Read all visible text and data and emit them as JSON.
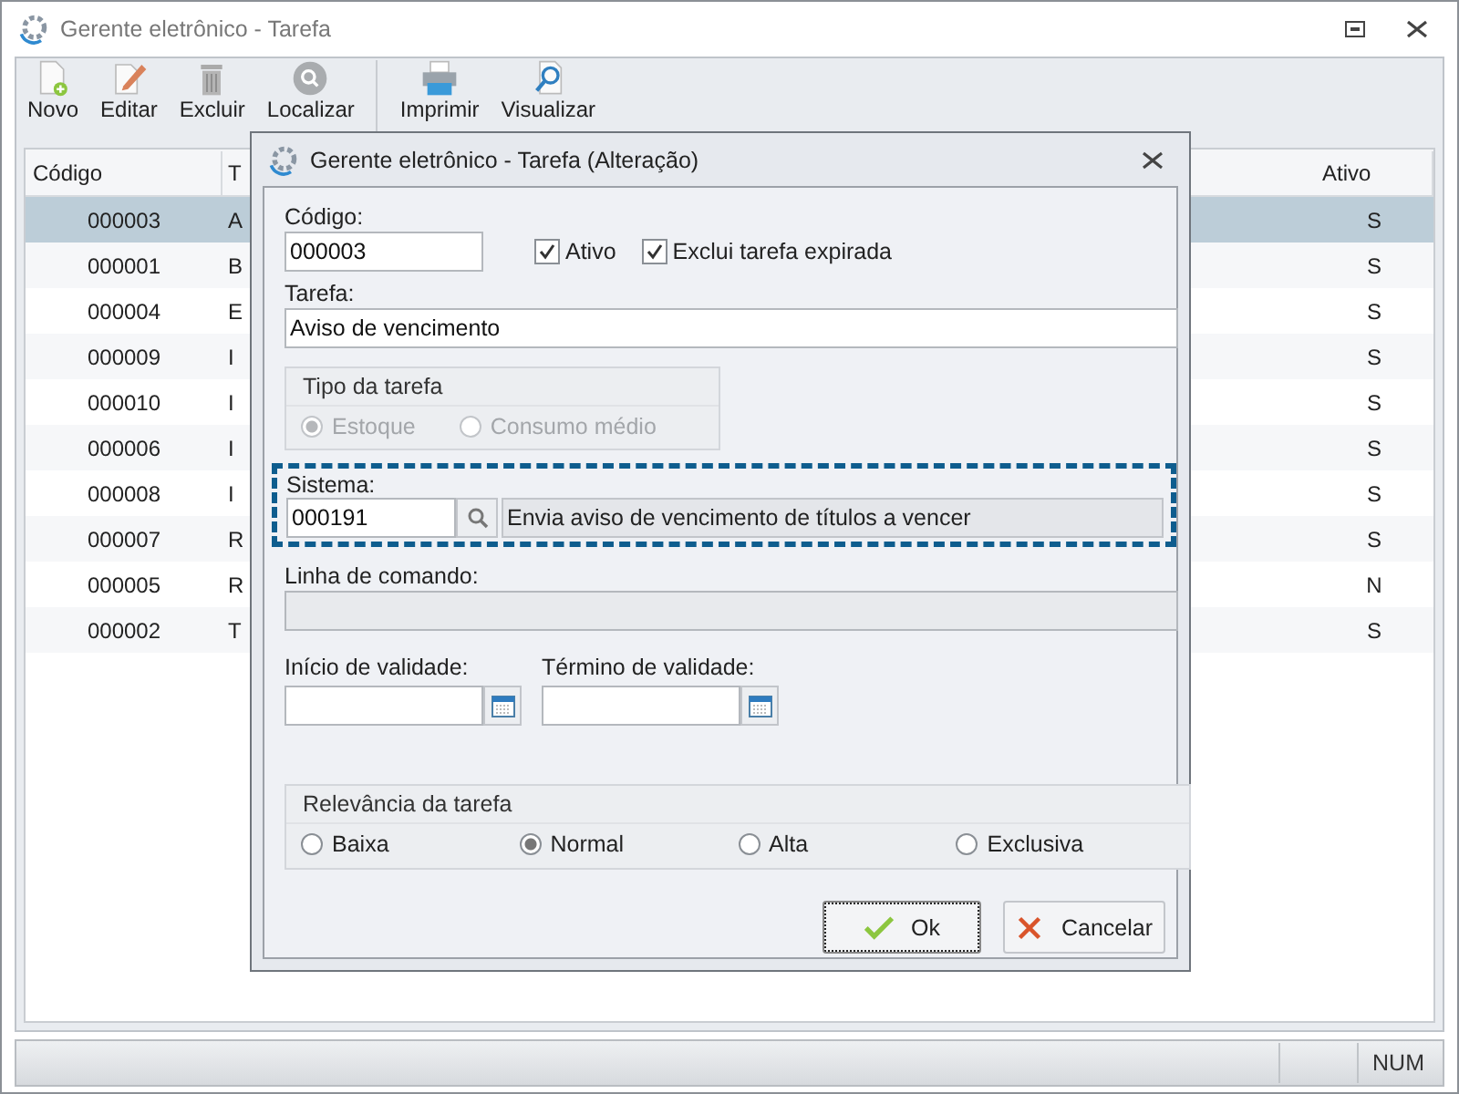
{
  "window": {
    "title": "Gerente eletrônico - Tarefa"
  },
  "toolbar": [
    {
      "label": "Novo"
    },
    {
      "label": "Editar"
    },
    {
      "label": "Excluir"
    },
    {
      "label": "Localizar"
    },
    {
      "label": "Imprimir"
    },
    {
      "label": "Visualizar"
    }
  ],
  "table": {
    "columns": [
      "Código",
      "T",
      "Ativo"
    ],
    "rows": [
      {
        "cells": [
          "000003",
          "A",
          "S"
        ],
        "selected": true
      },
      {
        "cells": [
          "000001",
          "B",
          "S"
        ],
        "selected": false
      },
      {
        "cells": [
          "000004",
          "E",
          "S"
        ],
        "selected": false
      },
      {
        "cells": [
          "000009",
          "I",
          "S"
        ],
        "selected": false
      },
      {
        "cells": [
          "000010",
          "I",
          "S"
        ],
        "selected": false
      },
      {
        "cells": [
          "000006",
          "I",
          "S"
        ],
        "selected": false
      },
      {
        "cells": [
          "000008",
          "I",
          "S"
        ],
        "selected": false
      },
      {
        "cells": [
          "000007",
          "R",
          "S"
        ],
        "selected": false
      },
      {
        "cells": [
          "000005",
          "R",
          "N"
        ],
        "selected": false
      },
      {
        "cells": [
          "000002",
          "T",
          "S"
        ],
        "selected": false
      }
    ]
  },
  "status_bar": {
    "text": "NUM"
  },
  "dialog": {
    "title": "Gerente eletrônico - Tarefa (Alteração)",
    "codigo": {
      "label": "Código:",
      "value": "000003"
    },
    "checkboxes": [
      {
        "label": "Ativo",
        "checked": true
      },
      {
        "label": "Exclui tarefa expirada",
        "checked": true
      }
    ],
    "tarefa": {
      "label": "Tarefa:",
      "value": "Aviso de vencimento"
    },
    "tipo": {
      "title": "Tipo da tarefa",
      "disabled": true,
      "options": [
        {
          "label": "Estoque",
          "selected": true
        },
        {
          "label": "Consumo médio",
          "selected": false
        }
      ]
    },
    "sistema": {
      "label": "Sistema:",
      "value": "000191",
      "description": "Envia aviso de vencimento de títulos a vencer",
      "highlighted": true
    },
    "linha": {
      "label": "Linha de comando:",
      "disabled": true
    },
    "dates": [
      {
        "label": "Início de validade:"
      },
      {
        "label": "Término de validade:"
      }
    ],
    "relevancia": {
      "title": "Relevância da tarefa",
      "options": [
        {
          "label": "Baixa",
          "selected": false
        },
        {
          "label": "Normal",
          "selected": true
        },
        {
          "label": "Alta",
          "selected": false
        },
        {
          "label": "Exclusiva",
          "selected": false
        }
      ]
    },
    "buttons": [
      {
        "label": "Ok",
        "kind": "ok",
        "focused": true
      },
      {
        "label": "Cancelar",
        "kind": "cancel",
        "focused": false
      }
    ]
  }
}
